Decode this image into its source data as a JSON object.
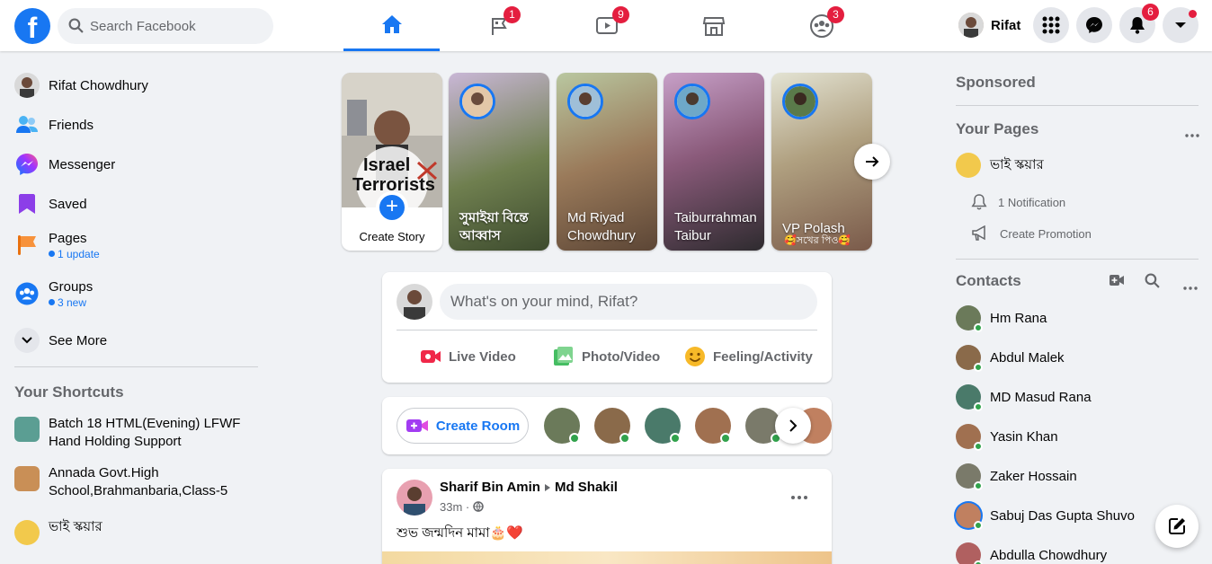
{
  "topbar": {
    "logo": "f",
    "search_placeholder": "Search Facebook",
    "tabs": [
      {
        "name": "home",
        "badge": ""
      },
      {
        "name": "pages",
        "badge": "1"
      },
      {
        "name": "watch",
        "badge": "9"
      },
      {
        "name": "marketplace",
        "badge": ""
      },
      {
        "name": "groups",
        "badge": "3"
      }
    ],
    "profile_name": "Rifat",
    "notifications_badge": "6",
    "accent": "#1877f2",
    "badge_color": "#e41e3f"
  },
  "left": {
    "items": [
      {
        "label": "Rifat Chowdhury",
        "icon": "profile-avatar",
        "sub": ""
      },
      {
        "label": "Friends",
        "icon": "friends-icon",
        "sub": ""
      },
      {
        "label": "Messenger",
        "icon": "messenger-icon",
        "sub": ""
      },
      {
        "label": "Saved",
        "icon": "saved-icon",
        "sub": ""
      },
      {
        "label": "Pages",
        "icon": "pages-flag-icon",
        "sub": "1 update"
      },
      {
        "label": "Groups",
        "icon": "groups-icon",
        "sub": "3 new"
      },
      {
        "label": "See More",
        "icon": "chevron-down-icon",
        "sub": ""
      }
    ],
    "shortcuts_title": "Your Shortcuts",
    "shortcuts": [
      {
        "label": "Batch 18 HTML(Evening) LFWF Hand Holding Support"
      },
      {
        "label": "Annada Govt.High School,Brahmanbaria,Class-5"
      },
      {
        "label": "ভাই স্কয়ার"
      }
    ]
  },
  "stories": {
    "create_label": "Create Story",
    "create_overlay_line1": "Israel",
    "create_overlay_line2": "Terrorists",
    "items": [
      {
        "name": "সুমাইয়া বিন্তে আব্বাস",
        "bg": "#7a8a5a"
      },
      {
        "name": "Md Riyad Chowdhury",
        "bg": "#9a7a5a"
      },
      {
        "name": "Taiburrahman Taibur",
        "bg": "#8a5a7a"
      },
      {
        "name": "VP Polash",
        "bg": "#b0a080",
        "sub": "🥰সখের পিও🥰"
      }
    ]
  },
  "composer": {
    "placeholder": "What's on your mind, Rifat?",
    "actions": [
      {
        "label": "Live Video",
        "icon": "live-video-icon",
        "color": "#f02849"
      },
      {
        "label": "Photo/Video",
        "icon": "photo-icon",
        "color": "#45bd62"
      },
      {
        "label": "Feeling/Activity",
        "icon": "feeling-icon",
        "color": "#f7b928"
      }
    ]
  },
  "rooms": {
    "create_label": "Create Room"
  },
  "post": {
    "author": "Sharif Bin Amin",
    "target": "Md Shakil",
    "time": "33m",
    "text": "শুভ জন্মদিন মামা🎂❤️"
  },
  "right": {
    "sponsored_title": "Sponsored",
    "your_pages_title": "Your Pages",
    "page_name": "ভাই স্কয়ার",
    "page_notification": "1 Notification",
    "page_promotion": "Create Promotion",
    "contacts_title": "Contacts",
    "contacts": [
      {
        "name": "Hm Rana",
        "color": "#6b7a5a"
      },
      {
        "name": "Abdul Malek",
        "color": "#8a6a4a"
      },
      {
        "name": "MD Masud Rana",
        "color": "#4a7a6a"
      },
      {
        "name": "Yasin Khan",
        "color": "#a07050"
      },
      {
        "name": "Zaker Hossain",
        "color": "#7a7a6a"
      },
      {
        "name": "Sabuj Das Gupta Shuvo",
        "color": "#c08060"
      },
      {
        "name": "Abdulla Chowdhury",
        "color": "#b06060"
      }
    ]
  }
}
